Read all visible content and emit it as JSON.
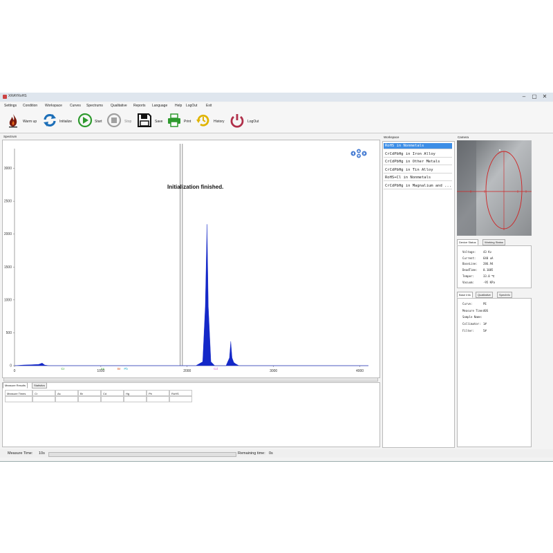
{
  "window": {
    "title": "XRAYRoHS",
    "controls": [
      "–",
      "▢",
      "✕"
    ]
  },
  "menu": [
    "Settings",
    "Condition",
    "Workspace",
    "Curves",
    "Spectrums",
    "Qualitative",
    "Reports",
    "Language",
    "Help",
    "LogOut",
    "Exit"
  ],
  "toolbar": [
    {
      "label": "Warm up",
      "icon": "flame-icon",
      "color": "#7a1a0e"
    },
    {
      "label": "Initialize",
      "icon": "refresh-icon",
      "color": "#1d6fb8"
    },
    {
      "label": "Start",
      "icon": "play-icon",
      "color": "#2e9a2e"
    },
    {
      "label": "Stop",
      "icon": "stop-icon",
      "color": "#9a9a9a"
    },
    {
      "label": "Save",
      "icon": "save-icon",
      "color": "#111111"
    },
    {
      "label": "Print",
      "icon": "printer-icon",
      "color": "#2e9a2e"
    },
    {
      "label": "History",
      "icon": "history-icon",
      "color": "#e0b400"
    },
    {
      "label": "LogOut",
      "icon": "power-icon",
      "color": "#b0304a"
    }
  ],
  "spectrum": {
    "panel_title": "Spectrum",
    "message": "Initialization finished.",
    "chart_data": {
      "type": "area",
      "x_ticks": [
        "0",
        "1000",
        "2000",
        "3000",
        "4000"
      ],
      "y_ticks": [
        "0",
        "500",
        "1000",
        "1500",
        "2000",
        "2500",
        "3000"
      ],
      "xlim": [
        0,
        4100
      ],
      "ylim": [
        0,
        3300
      ],
      "series": [
        {
          "points": [
            [
              0,
              0
            ],
            [
              100,
              10
            ],
            [
              200,
              15
            ],
            [
              280,
              20
            ],
            [
              320,
              40
            ],
            [
              350,
              10
            ],
            [
              400,
              0
            ],
            [
              2100,
              0
            ],
            [
              2180,
              60
            ],
            [
              2210,
              900
            ],
            [
              2230,
              2150
            ],
            [
              2245,
              900
            ],
            [
              2275,
              60
            ],
            [
              2320,
              0
            ],
            [
              2450,
              0
            ],
            [
              2490,
              120
            ],
            [
              2505,
              370
            ],
            [
              2520,
              120
            ],
            [
              2540,
              50
            ],
            [
              2560,
              30
            ],
            [
              2600,
              0
            ],
            [
              4100,
              0
            ]
          ],
          "color": "#1428c8"
        }
      ],
      "cursor_x": [
        1920,
        1945
      ],
      "element_markers": [
        {
          "label": "Cr",
          "x": 560,
          "color": "#2ea02e"
        },
        {
          "label": "As",
          "x": 1020,
          "color": "#2ea02e"
        },
        {
          "label": "Br",
          "x": 1210,
          "color": "#d9531e"
        },
        {
          "label": "Pb",
          "x": 1290,
          "color": "#22aacc"
        },
        {
          "label": "Cd",
          "x": 2330,
          "color": "#cc55cc"
        }
      ]
    }
  },
  "results": {
    "tabs": [
      "Measure Results",
      "Statistics"
    ],
    "columns": [
      "Measure Times",
      "Cr",
      "As",
      "Br",
      "Cd",
      "Hg",
      "Pb",
      "RoHS"
    ]
  },
  "workspace": {
    "title": "Workspace",
    "items": [
      "RoHS in Nonmetals",
      "CrCdPbHg in Iron Alloy",
      "CrCdPbHg in Other Metals",
      "CrCdPbHg in Tin Alloy",
      "RoHS+Cl in Nonmetals",
      "CrCdPbHg in Magnalium and ..."
    ],
    "selected": 0
  },
  "camera": {
    "title": "Camera"
  },
  "device_status": {
    "tabs": [
      "Device Status",
      "Working Status"
    ],
    "rows": [
      {
        "k": "Voltage:",
        "v": "43 Kv"
      },
      {
        "k": "Current:",
        "v": "640 uA"
      },
      {
        "k": "BaseLine:",
        "v": "286.94"
      },
      {
        "k": "DeadTime:",
        "v": "0.1085"
      },
      {
        "k": "Temper:",
        "v": "33.0 ℃"
      },
      {
        "k": "Vacuum:",
        "v": "-95 KPa"
      }
    ]
  },
  "base_info": {
    "tabs": [
      "Base Info",
      "Qualitative",
      "SpecInfo"
    ],
    "rows": [
      {
        "k": "Curve:",
        "v": "PE"
      },
      {
        "k": "Measure Time:",
        "v": "40S"
      },
      {
        "k": "Sample Name:",
        "v": ""
      },
      {
        "k": "Collimator:",
        "v": "1#"
      },
      {
        "k": "Filter:",
        "v": "5#"
      }
    ]
  },
  "status": {
    "measure_label": "Measure Time:",
    "measure_value": "10s",
    "remaining_label": "Remaining time:",
    "remaining_value": "0s"
  }
}
